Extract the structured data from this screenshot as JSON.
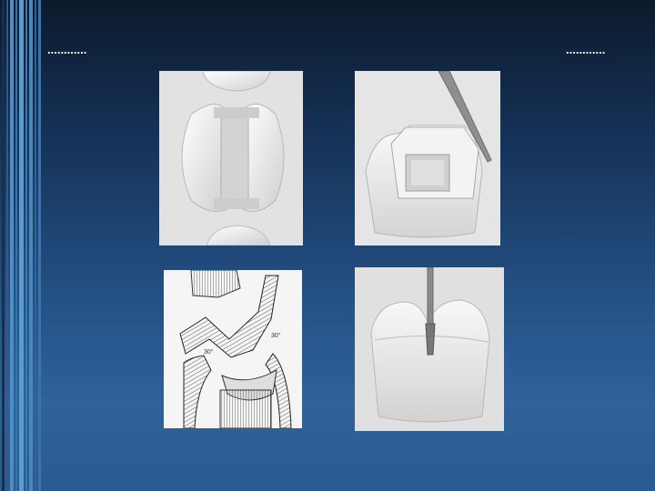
{
  "slide": {
    "heading_left": "............",
    "heading_right": "............"
  },
  "figures": [
    {
      "name": "tooth-occlusal-view"
    },
    {
      "name": "tooth-preparation-with-instrument"
    },
    {
      "name": "tooth-cross-section-diagram",
      "angle_labels": [
        "30°",
        "30°"
      ]
    },
    {
      "name": "tooth-with-bur"
    }
  ],
  "colors": {
    "background_top": "#0c1a2d",
    "background_bottom": "#2e6299",
    "stripe_accent": "#4f8ec4"
  }
}
